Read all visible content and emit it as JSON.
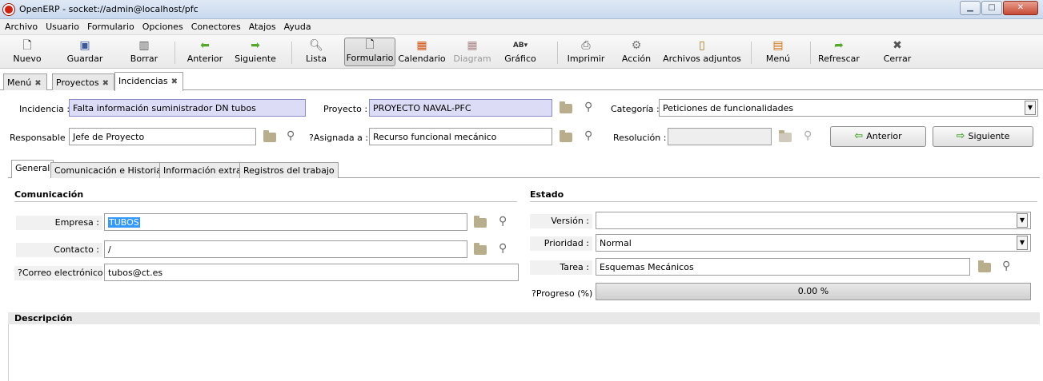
{
  "window": {
    "title": "OpenERP - socket://admin@localhost/pfc"
  },
  "menubar": [
    "Archivo",
    "Usuario",
    "Formulario",
    "Opciones",
    "Conectores",
    "Atajos",
    "Ayuda"
  ],
  "toolbar": {
    "nuevo": "Nuevo",
    "guardar": "Guardar",
    "borrar": "Borrar",
    "anterior": "Anterior",
    "siguiente": "Siguiente",
    "lista": "Lista",
    "formulario": "Formulario",
    "calendario": "Calendario",
    "diagram": "Diagram",
    "grafico": "Gráfico",
    "imprimir": "Imprimir",
    "accion": "Acción",
    "adjuntos": "Archivos adjuntos",
    "menu": "Menú",
    "refrescar": "Refrescar",
    "cerrar": "Cerrar"
  },
  "doctabs": [
    "Menú",
    "Proyectos",
    "Incidencias"
  ],
  "header": {
    "incidencia_label": "Incidencia :",
    "incidencia_value": "Falta información suministrador DN tubos",
    "proyecto_label": "Proyecto :",
    "proyecto_value": "PROYECTO NAVAL-PFC",
    "categoria_label": "Categoría :",
    "categoria_value": "Peticiones de funcionalidades",
    "responsable_label": "Responsable :",
    "responsable_value": "Jefe de Proyecto",
    "asignada_label": "?Asignada a :",
    "asignada_value": "Recurso funcional mecánico",
    "resolucion_label": "Resolución :",
    "resolucion_value": "",
    "prev_button": "Anterior",
    "next_button": "Siguiente"
  },
  "subtabs": [
    "General",
    "Comunicación e Historial",
    "Información extra",
    "Registros del trabajo"
  ],
  "comunicacion": {
    "title": "Comunicación",
    "empresa_label": "Empresa :",
    "empresa_value": "TUBOS",
    "contacto_label": "Contacto :",
    "contacto_value": "/",
    "correo_label": "?Correo electrónico :",
    "correo_value": "tubos@ct.es"
  },
  "estado": {
    "title": "Estado",
    "version_label": "Versión :",
    "version_value": "",
    "prioridad_label": "Prioridad :",
    "prioridad_value": "Normal",
    "tarea_label": "Tarea :",
    "tarea_value": "Esquemas Mecánicos",
    "progreso_label": "?Progreso (%) :",
    "progreso_text": "0.00 %",
    "progreso_fraction": 0.0
  },
  "descripcion": {
    "title": "Descripción"
  }
}
